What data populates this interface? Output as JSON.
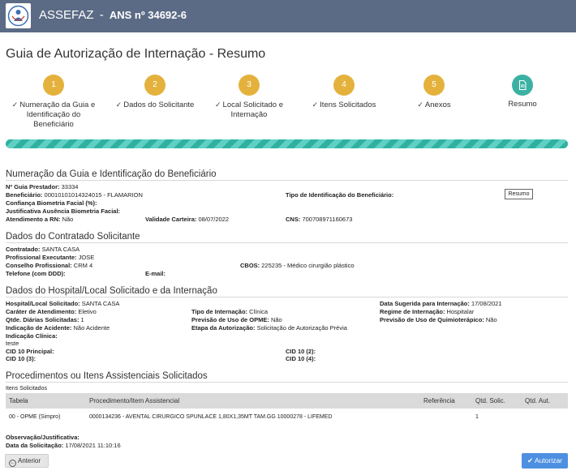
{
  "header": {
    "brand": "ASSEFAZ",
    "separator": "-",
    "ans": "ANS nº 34692-6"
  },
  "page_title": "Guia de Autorização de Internação - Resumo",
  "steps": [
    {
      "number": "1",
      "line1": "Numeração da Guia e",
      "line2": "Identificação do",
      "line3": "Beneficiário"
    },
    {
      "number": "2",
      "line1": "Dados do Solicitante"
    },
    {
      "number": "3",
      "line1": "Local Solicitado e",
      "line2": "Internação"
    },
    {
      "number": "4",
      "line1": "Itens Solicitados"
    },
    {
      "number": "5",
      "line1": "Anexos"
    },
    {
      "line1": "Resumo"
    }
  ],
  "progress_fraction": 1.0,
  "colors": {
    "header_bg": "#5b6b85",
    "step_done": "#e4b23c",
    "step_current": "#3bb1a3",
    "progress": "#2fb1a2",
    "primary_button": "#4d8fe0"
  },
  "section1": {
    "title": "Numeração da Guia e Identificação do Beneficiário",
    "guia_label": "Nº Guia Prestador:",
    "guia_value": "33334",
    "benef_label": "Beneficiário:",
    "benef_value": "00010101014324015 - FLAMARION",
    "confianca_label": "Confiança Biometria Facial (%):",
    "justif_label": "Justificativa Ausência Biometria Facial:",
    "rn_label": "Atendimento a RN:",
    "rn_value": "Não",
    "validade_label": "Validade Carteira:",
    "validade_value": "08/07/2022",
    "cns_label": "CNS:",
    "cns_value": "700708971160673",
    "tipo_id_label": "Tipo de Identificação do Beneficiário:",
    "resumo_button": "Resumo"
  },
  "section2": {
    "title": "Dados do Contratado Solicitante",
    "contratado_label": "Contratado:",
    "contratado_value": "SANTA CASA",
    "prof_label": "Profissional Executante:",
    "prof_value": "JOSE",
    "conselho_label": "Conselho Profissional:",
    "conselho_value": "CRM 4",
    "cbos_label": "CBOS:",
    "cbos_value": "225235 - Médico cirurgião plástico",
    "tel_label": "Telefone (com DDD):",
    "email_label": "E-mail:"
  },
  "section3": {
    "title": "Dados do Hospital/Local Solicitado e da Internação",
    "hospital_label": "Hospital/Local Solicitado:",
    "hospital_value": "SANTA CASA",
    "data_sug_label": "Data Sugerida para Internação:",
    "data_sug_value": "17/08/2021",
    "carater_label": "Caráter de Atendimento:",
    "carater_value": "Eletivo",
    "tipo_int_label": "Tipo de Internação:",
    "tipo_int_value": "Clínica",
    "regime_label": "Regime de Internação:",
    "regime_value": "Hospitalar",
    "qtde_label": "Qtde. Diárias Solicitadas:",
    "qtde_value": "1",
    "opme_label": "Previsão de Uso de OPME:",
    "opme_value": "Não",
    "quimio_label": "Previsão de Uso de Quimioterápico:",
    "quimio_value": "Não",
    "acidente_label": "Indicação de Acidente:",
    "acidente_value": "Não Acidente",
    "etapa_label": "Etapa da Autorização:",
    "etapa_value": "Solicitação de Autorização Prévia",
    "indicacao_label": "Indicação Clínica:",
    "indicacao_value": "teste",
    "cid_principal_label": "CID 10 Principal:",
    "cid2_label": "CID 10 (2):",
    "cid3_label": "CID 10 (3):",
    "cid4_label": "CID 10 (4):"
  },
  "section4": {
    "title": "Procedimentos ou Itens Assistenciais Solicitados",
    "subtitle": "Itens Solicitados",
    "columns": [
      "Tabela",
      "Procedimento/Item Assistencial",
      "Referência",
      "Qtd. Solic.",
      "Qtd. Aut."
    ],
    "rows": [
      {
        "tabela": "00 - OPME (Simpro)",
        "item": "0000134236 - AVENTAL CIRURGICO SPUNLACE 1,80X1,35MT TAM.GG 10000278 - LIFEMED",
        "referencia": "",
        "qtd_solic": "1",
        "qtd_aut": ""
      }
    ],
    "obs_label": "Observação/Justificativa:",
    "data_sol_label": "Data da Solicitação:",
    "data_sol_value": "17/08/2021 11:10:16"
  },
  "footer": {
    "anterior_label": "Anterior",
    "autorizar_label": "Autorizar",
    "anterior_icon": "arrow-left-circle-icon",
    "autorizar_icon": "check-icon"
  }
}
